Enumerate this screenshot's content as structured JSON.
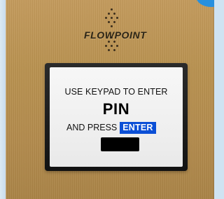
{
  "device": {
    "brand": "FLOWPOINT",
    "screen": {
      "line1": "USE KEYPAD TO ENTER",
      "line2": "PIN",
      "line3_prefix": "AND PRESS",
      "enter_badge": "ENTER",
      "pin_value": ""
    }
  },
  "colors": {
    "panel": "#b8914f",
    "screen_bg": "#f2f2f2",
    "enter_badge_bg": "#0b4fd6",
    "pin_field_bg": "#000000",
    "accent_blue": "#1f8fe6"
  },
  "icons": {
    "speaker": "speaker-grille-icon"
  }
}
